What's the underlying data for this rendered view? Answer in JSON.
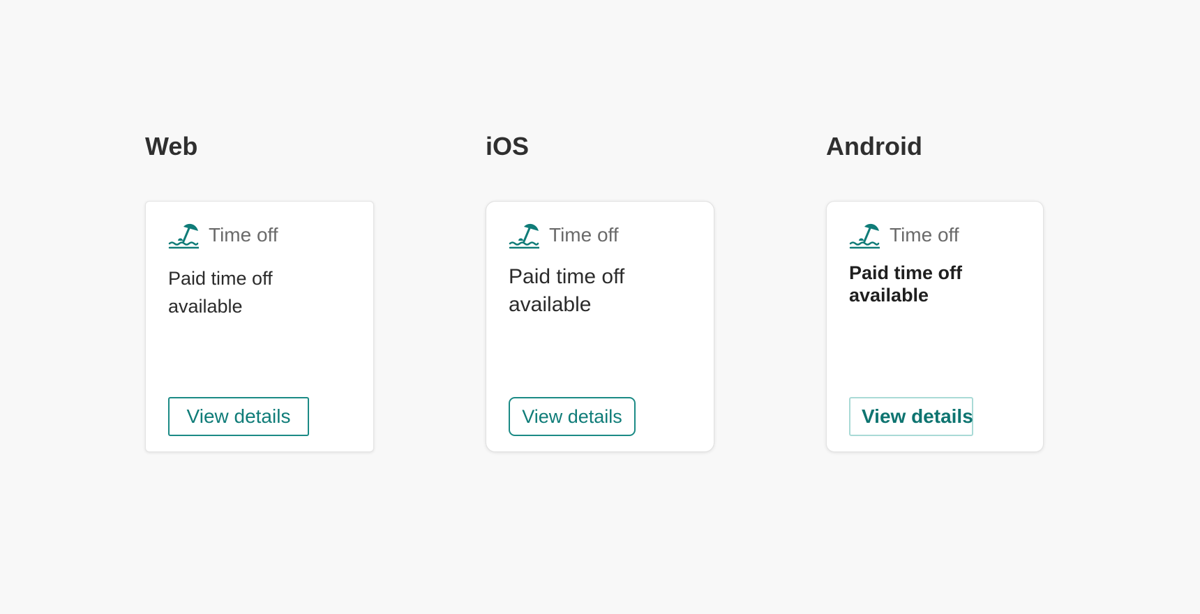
{
  "platforms": [
    {
      "name": "Web",
      "card": {
        "icon": "beach-umbrella-icon",
        "label": "Time off",
        "body_line1": "Paid time off",
        "body_line2": "available",
        "button": "View details"
      }
    },
    {
      "name": "iOS",
      "card": {
        "icon": "beach-umbrella-icon",
        "label": "Time off",
        "body_line1": "Paid time off",
        "body_line2": "available",
        "button": "View details"
      }
    },
    {
      "name": "Android",
      "card": {
        "icon": "beach-umbrella-icon",
        "label": "Time off",
        "body_line1": "Paid time off",
        "body_line2": "available",
        "button": "View details"
      }
    }
  ],
  "colors": {
    "accent": "#0f7c78",
    "background": "#f8f8f8",
    "card": "#ffffff"
  }
}
